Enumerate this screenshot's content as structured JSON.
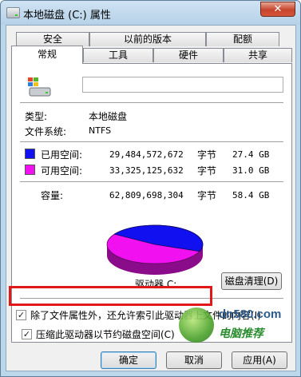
{
  "window": {
    "title": "本地磁盘 (C:) 属性",
    "close_glyph": "✕"
  },
  "tabs": {
    "row1": [
      "安全",
      "以前的版本",
      "配额"
    ],
    "row2": [
      "常规",
      "工具",
      "硬件",
      "共享"
    ],
    "active": "常规"
  },
  "general": {
    "drive_icon": "drive-windows-icon",
    "name_value": "",
    "type_label": "类型:",
    "type_value": "本地磁盘",
    "fs_label": "文件系统:",
    "fs_value": "NTFS",
    "used": {
      "label": "已用空间:",
      "bytes": "29,484,572,672",
      "unit": "字节",
      "size": "27.4 GB",
      "color": "#1010f0"
    },
    "free": {
      "label": "可用空间:",
      "bytes": "33,325,125,632",
      "unit": "字节",
      "size": "31.0 GB",
      "color": "#f010f0"
    },
    "capacity": {
      "label": "容量:",
      "bytes": "62,809,698,304",
      "unit": "字节",
      "size": "58.4 GB"
    },
    "drive_label": "驱动器 C:",
    "cleanup_button": "磁盘清理(D)",
    "used_fraction": 0.469
  },
  "options": {
    "compress": {
      "label": "压缩此驱动器以节约磁盘空间(C)",
      "checked": true
    },
    "index": {
      "label": "除了文件属性外，还允许索引此驱动器上文件的内容(I)",
      "checked": true
    }
  },
  "buttons": {
    "ok": "确定",
    "cancel": "取消",
    "apply": "应用(A)"
  },
  "watermark": {
    "url": "dn580.com",
    "text": "电脑推荐"
  }
}
